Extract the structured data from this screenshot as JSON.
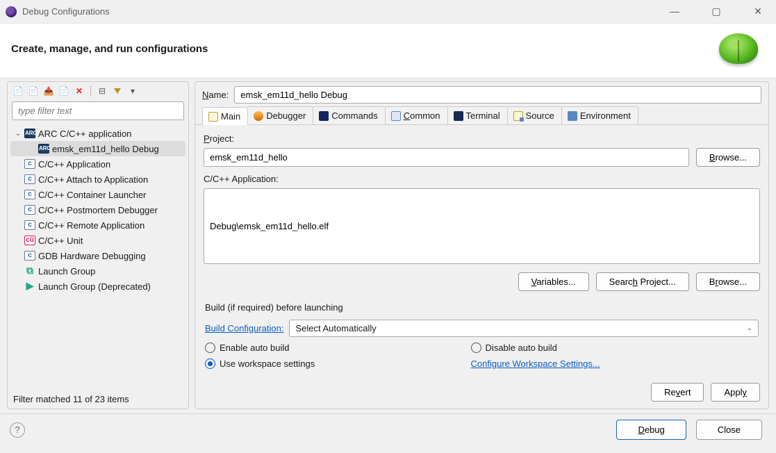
{
  "window": {
    "title": "Debug Configurations"
  },
  "banner": {
    "heading": "Create, manage, and run configurations"
  },
  "filter": {
    "placeholder": "type filter text"
  },
  "tree": {
    "mainNode": "ARC C/C++ application",
    "child": "emsk_em11d_hello Debug",
    "items": [
      "C/C++ Application",
      "C/C++ Attach to Application",
      "C/C++ Container Launcher",
      "C/C++ Postmortem Debugger",
      "C/C++ Remote Application",
      "C/C++ Unit",
      "GDB Hardware Debugging",
      "Launch Group",
      "Launch Group (Deprecated)"
    ]
  },
  "status": "Filter matched 11 of 23 items",
  "form": {
    "nameLabel": "Name:",
    "nameValue": "emsk_em11d_hello Debug",
    "tabs": [
      "Main",
      "Debugger",
      "Commands",
      "Common",
      "Terminal",
      "Source",
      "Environment"
    ],
    "projectLabel": "Project:",
    "projectValue": "emsk_em11d_hello",
    "browse": "Browse...",
    "appLabel": "C/C++ Application:",
    "appValue": "Debug\\emsk_em11d_hello.elf",
    "variables": "Variables...",
    "searchProject": "Search Project...",
    "groupTitle": "Build (if required) before launching",
    "buildCfgLabel": "Build Configuration:",
    "buildCfgValue": "Select Automatically",
    "radioEnable": "Enable auto build",
    "radioDisable": "Disable auto build",
    "radioWorkspace": "Use workspace settings",
    "cfgWorkspace": "Configure Workspace Settings...",
    "revert": "Revert",
    "apply": "Apply"
  },
  "footer": {
    "debug": "Debug",
    "close": "Close"
  }
}
